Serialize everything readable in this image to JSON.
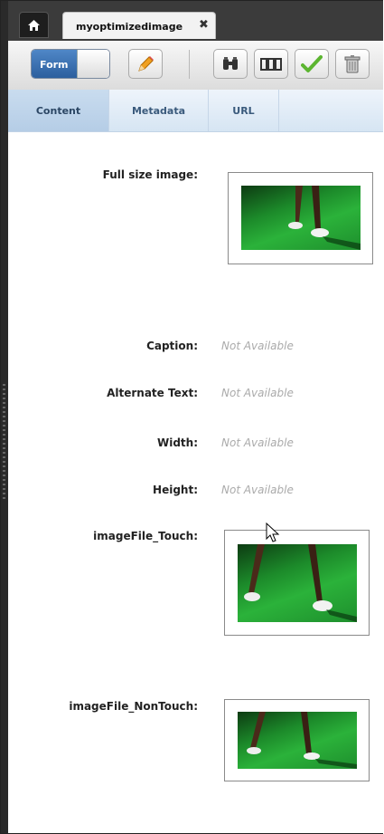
{
  "tab": {
    "title": "myoptimizedimage",
    "close_glyph": "✖"
  },
  "toolbar": {
    "mode_label": "Form"
  },
  "subtabs": [
    "Content",
    "Metadata",
    "URL"
  ],
  "fields": {
    "full_size_image": "Full size image:",
    "caption": {
      "label": "Caption:",
      "value": "Not Available"
    },
    "alternate_text": {
      "label": "Alternate Text:",
      "value": "Not Available"
    },
    "width": {
      "label": "Width:",
      "value": "Not Available"
    },
    "height": {
      "label": "Height:",
      "value": "Not Available"
    },
    "image_touch": "imageFile_Touch:",
    "image_nontouch": "imageFile_NonTouch:"
  },
  "icons": [
    "home-icon",
    "pencil-icon",
    "binoculars-icon",
    "layout-icon",
    "checkmark-icon",
    "trash-icon"
  ],
  "colors": {
    "toggle_active": "#2c5f9e",
    "subtab_bg": "#d6e5f3",
    "image_green": "#2bb23a"
  }
}
